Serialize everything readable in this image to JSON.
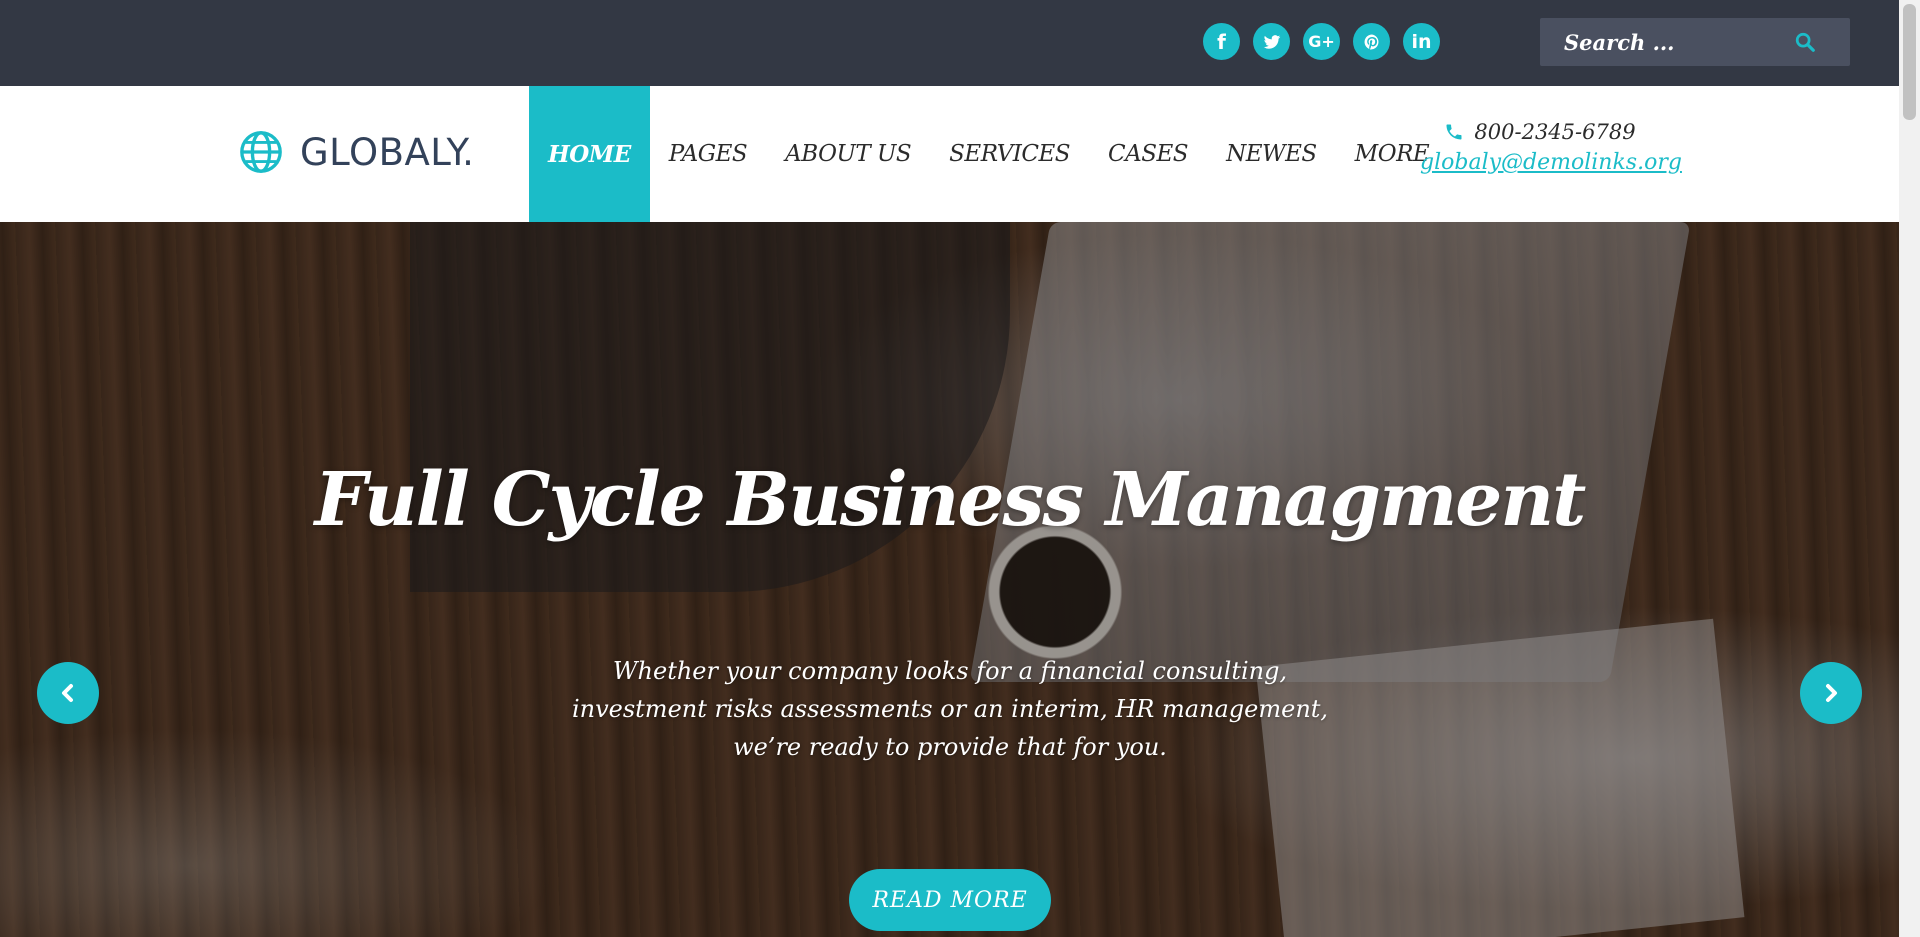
{
  "topbar": {
    "social": [
      {
        "name": "facebook-icon",
        "label": "f"
      },
      {
        "name": "twitter-icon",
        "label": ""
      },
      {
        "name": "google-plus-icon",
        "label": "G+"
      },
      {
        "name": "pinterest-icon",
        "label": ""
      },
      {
        "name": "linkedin-icon",
        "label": "in"
      }
    ],
    "search_placeholder": "Search ..."
  },
  "header": {
    "logo_text": "GLOBALY.",
    "nav": [
      "HOME",
      "PAGES",
      "ABOUT US",
      "SERVICES",
      "CASES",
      "NEWES",
      "MORE"
    ],
    "active_nav": "HOME",
    "phone": "800-2345-6789",
    "email": "globaly@demolinks.org"
  },
  "hero": {
    "title": "Full Cycle Business Managment",
    "text": "Whether your company looks for a financial consulting, investment risks assessments or an interim, HR management, we’re ready to provide that for you.",
    "button": "READ MORE"
  },
  "colors": {
    "accent": "#1bbcc8",
    "topbar": "#333844",
    "search_bg": "#4a5060",
    "logo": "#33425a"
  }
}
